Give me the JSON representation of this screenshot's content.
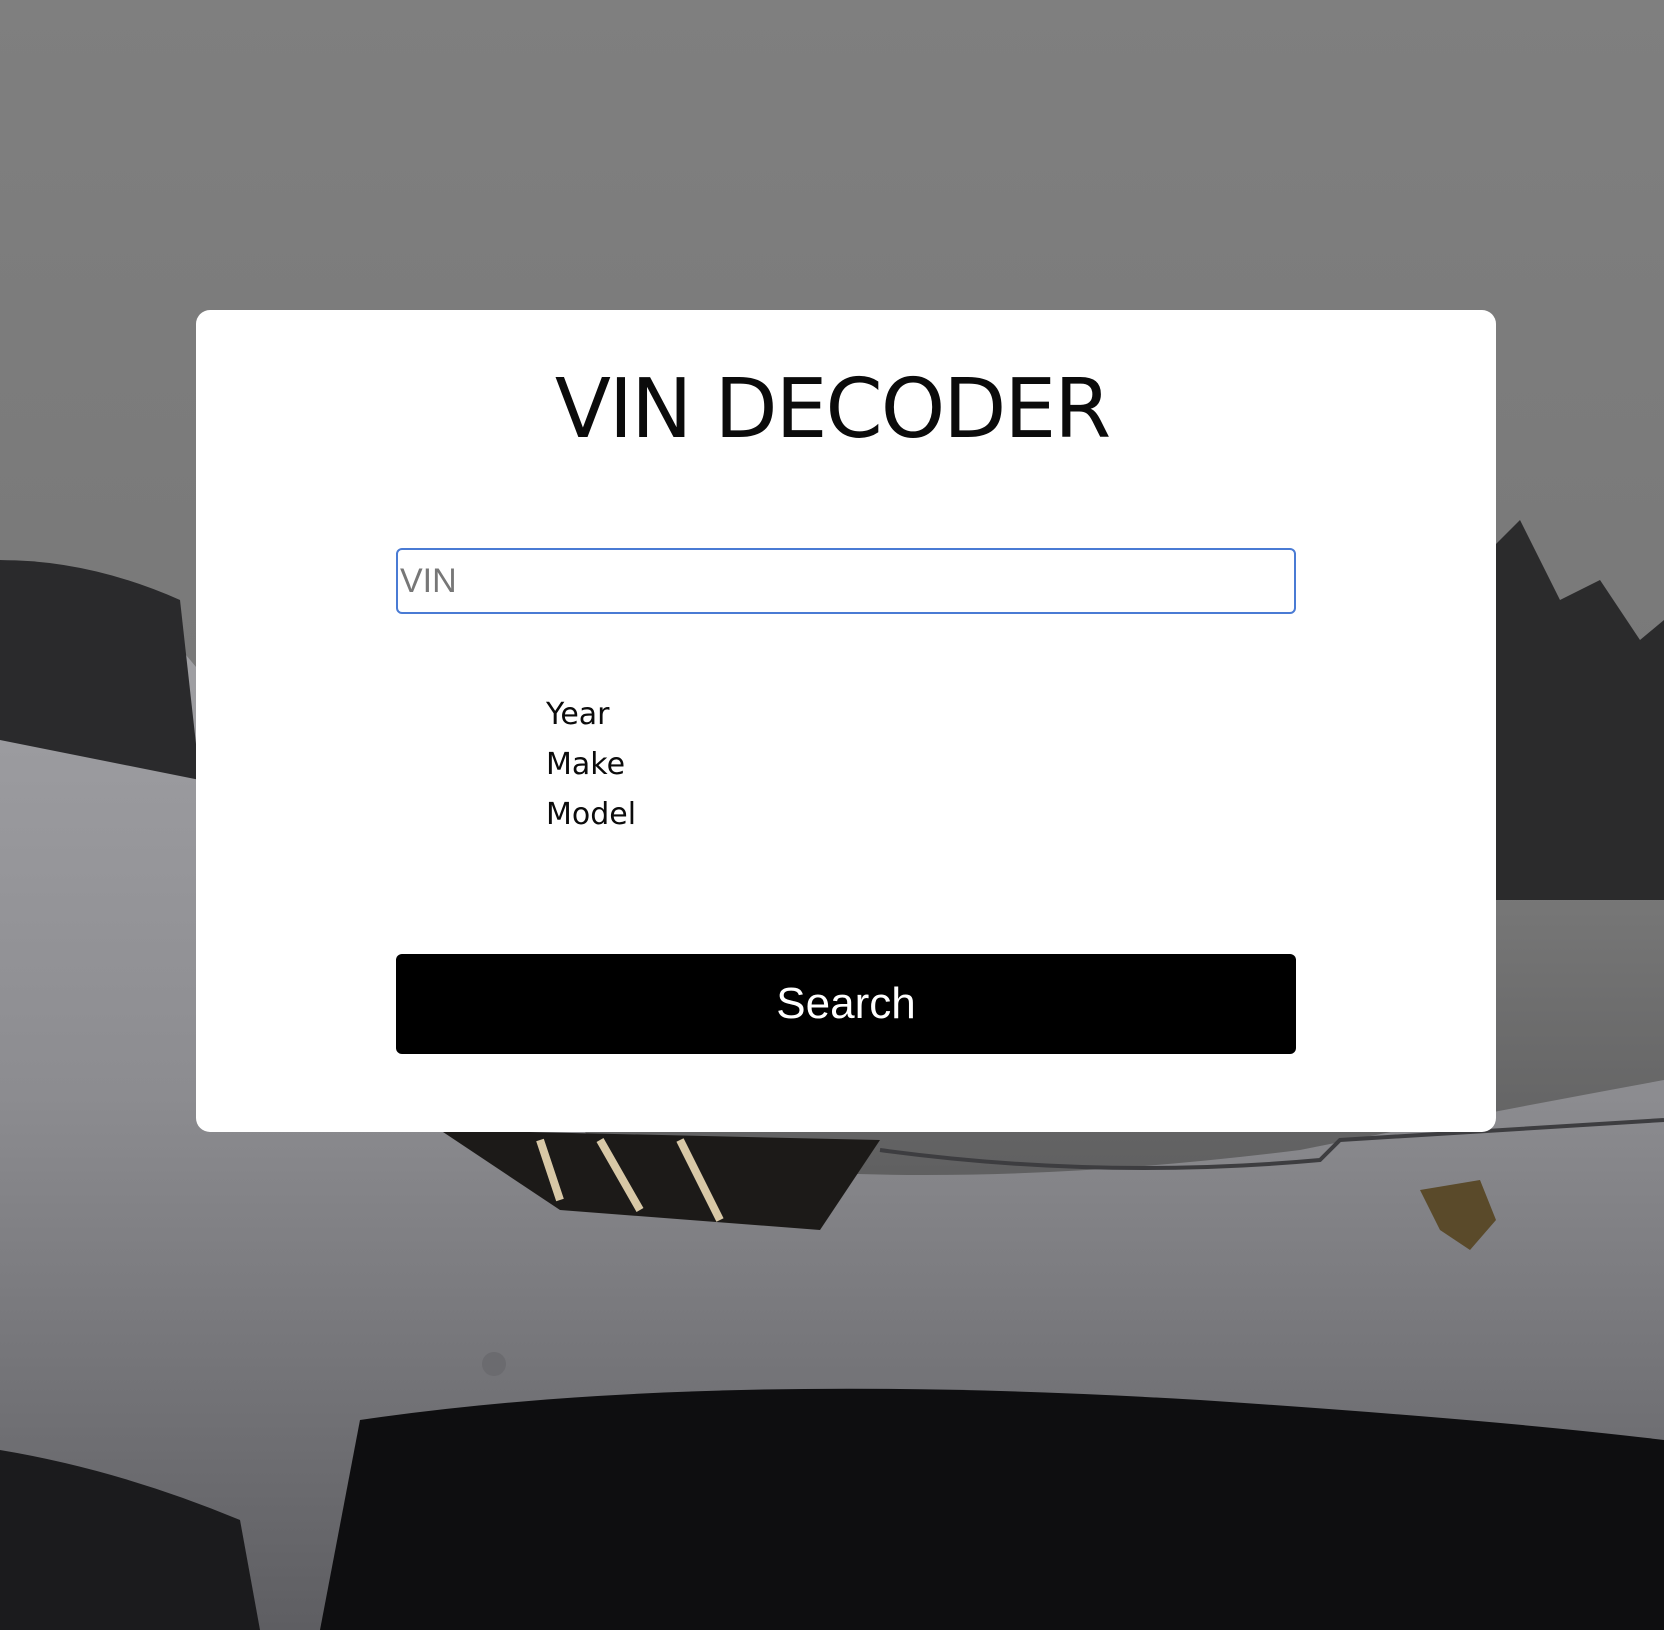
{
  "page": {
    "title": "VIN DECODER"
  },
  "form": {
    "vin_placeholder": "VIN",
    "vin_value": "",
    "fields": [
      {
        "label": "Year"
      },
      {
        "label": "Make"
      },
      {
        "label": "Model"
      }
    ],
    "search_label": "Search"
  },
  "background": {
    "subject": "white sports car front view, dimmed overlay",
    "overlay_color": "#7f7f7f",
    "car_color": "#c9c9cc",
    "ground_color": "#0e0e10"
  }
}
